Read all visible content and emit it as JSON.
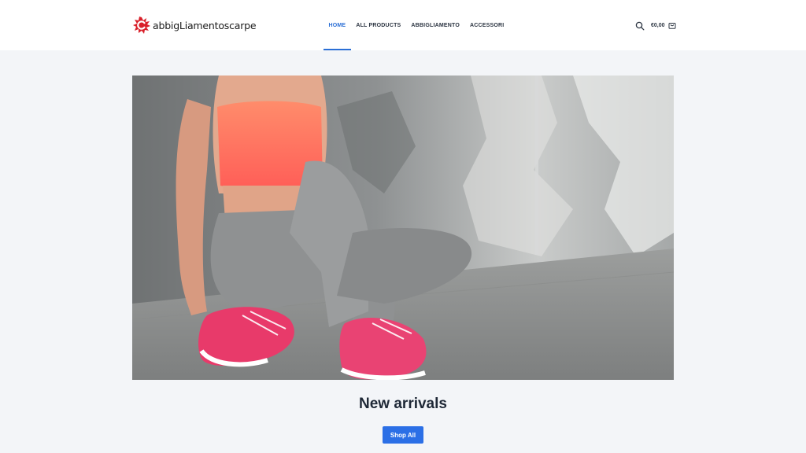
{
  "brand": {
    "logo_text": "abbigLiamentoscarpe",
    "logo_icon": "red-splash-c-icon",
    "accent_color": "#2b6fd6"
  },
  "nav": {
    "items": [
      {
        "label": "HOME",
        "active": true
      },
      {
        "label": "ALL PRODUCTS",
        "active": false
      },
      {
        "label": "ABBIGLIAMENTO",
        "active": false
      },
      {
        "label": "ACCESSORI",
        "active": false
      }
    ]
  },
  "header_actions": {
    "search_icon": "search-icon",
    "cart_total": "€0,00",
    "cart_icon": "shopping-bag-icon"
  },
  "hero": {
    "image_description": "woman in coral sports top, grey leggings and pink sneakers sitting against concrete wall"
  },
  "section": {
    "title": "New arrivals",
    "button_label": "Shop All",
    "button_color": "#2b6fe6"
  }
}
